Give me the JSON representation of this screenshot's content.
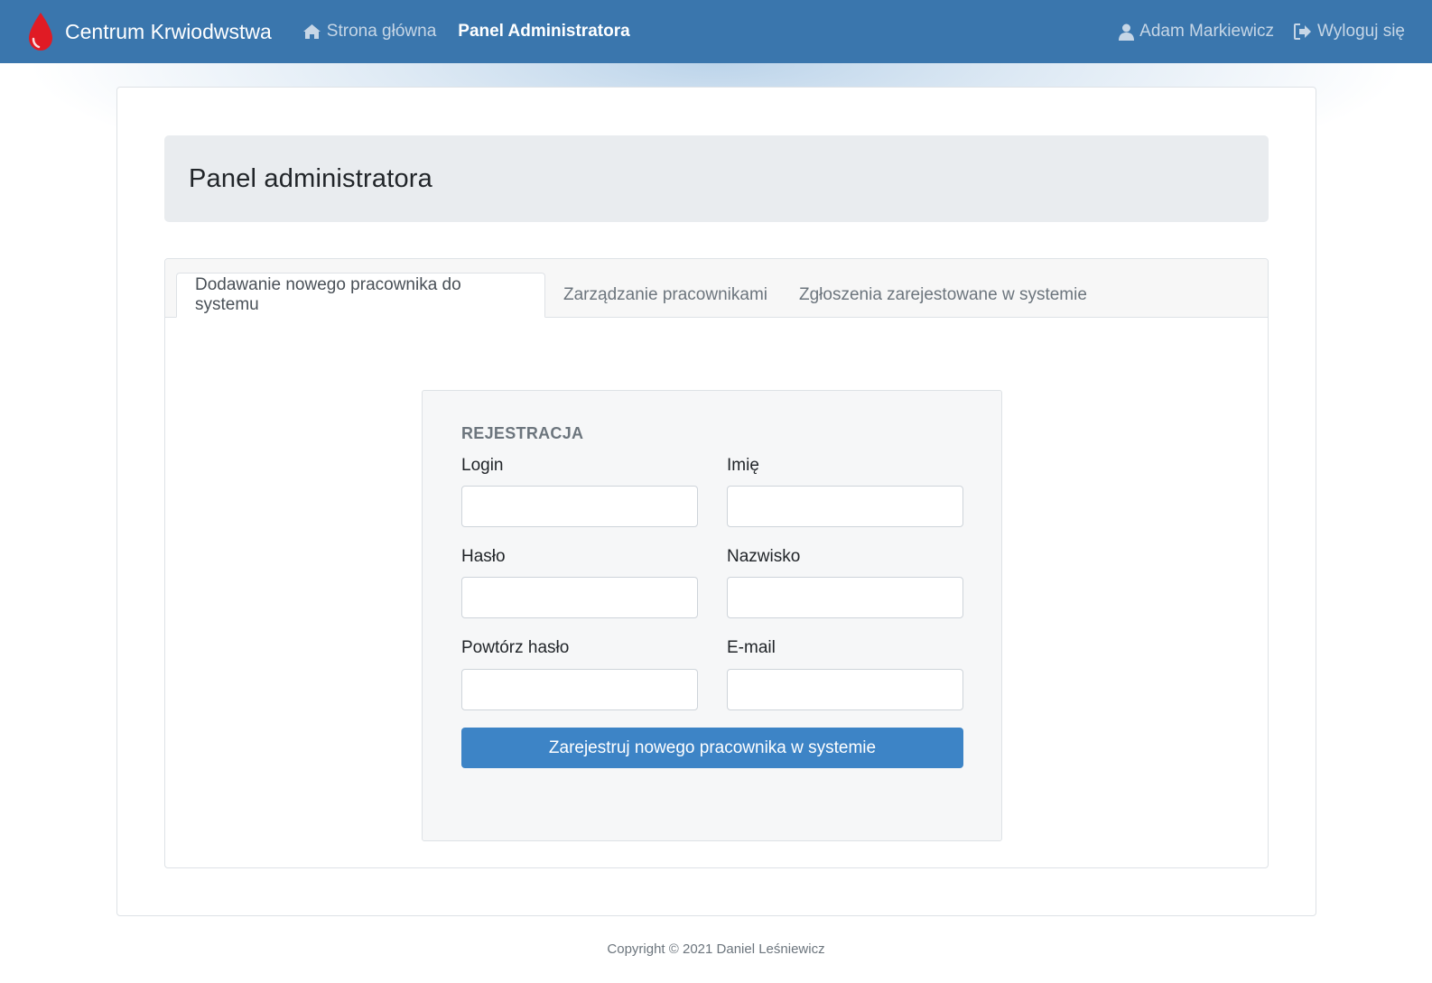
{
  "navbar": {
    "brand": "Centrum Krwiodwstwa",
    "links": {
      "home": "Strona główna",
      "admin": "Panel Administratora"
    },
    "user_name": "Adam Markiewicz",
    "logout": "Wyloguj się"
  },
  "jumbotron": {
    "title": "Panel administratora"
  },
  "tabs": [
    {
      "label": "Dodawanie nowego pracownika do systemu",
      "active": true
    },
    {
      "label": "Zarządzanie pracownikami",
      "active": false
    },
    {
      "label": "Zgłoszenia zarejestowane w systemie",
      "active": false
    }
  ],
  "form": {
    "heading": "REJESTRACJA",
    "fields": {
      "login": {
        "label": "Login",
        "value": ""
      },
      "first_name": {
        "label": "Imię",
        "value": ""
      },
      "password": {
        "label": "Hasło",
        "value": ""
      },
      "last_name": {
        "label": "Nazwisko",
        "value": ""
      },
      "password_repeat": {
        "label": "Powtórz hasło",
        "value": ""
      },
      "email": {
        "label": "E-mail",
        "value": ""
      }
    },
    "submit_label": "Zarejestruj nowego pracownika w systemie"
  },
  "footer": {
    "copyright": "Copyright © 2021 Daniel Leśniewicz"
  },
  "colors": {
    "navbar": "#3a76ad",
    "primary_button": "#3d84c6",
    "blood_drop": "#e01b24"
  },
  "icons": {
    "brand": "blood-drop-icon",
    "home": "home-icon",
    "user": "user-icon",
    "logout": "sign-out-icon"
  }
}
